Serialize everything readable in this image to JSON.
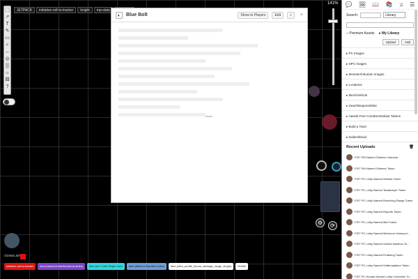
{
  "canvas": {
    "zoom": "141%",
    "tabs": [
      "JETPACK",
      "initiative-roll-to-tracker",
      "knight",
      "mp-stats",
      "target-pic"
    ]
  },
  "toolbar": {
    "tools": [
      "select-icon",
      "pointer-icon",
      "text-icon",
      "draw-icon",
      "shapes-icon",
      "zoom-icon",
      "measure-icon",
      "ping-icon",
      "fog-icon",
      "lighting-icon",
      "dice-icon",
      "help-icon"
    ]
  },
  "modal": {
    "title": "Blue Bolt",
    "show_to_players": "Show to Players",
    "edit": "Edit"
  },
  "sidebar": {
    "search_label": "Search:",
    "library_select": "Library",
    "radio_premium": "Premium Assets",
    "radio_library": "My Library",
    "upload": "Upload",
    "add": "Add",
    "categories": [
      "PC Images",
      "NPC Images",
      "Monster/Inhuman Images",
      "Locations",
      "Mech/Vehicle",
      "Gear/Weapons/Misc",
      "Hassle-Free Combat Modular Tokens",
      "Build a Town",
      "bodies/blood"
    ],
    "recent_title": "Recent Uploads",
    "recent_items": [
      "FIST PM Named Glimmer Handout",
      "FIST PM Named Glimmer Token",
      "FIST PC Leiby Named Wriesla Token",
      "FIST PC Leiby Named Tavakeeper Token",
      "FIST PC Leiby Named Resolving Range Token",
      "FIST PC Leiby Named Reports Token",
      "FIST PC Leiby Named Mint Token",
      "FIST PC Leiby Named Minicious Honeycut...",
      "FIST PC Leiby Named Golden Bamboo To...",
      "FIST PC Leiby Named Fluttering Token",
      "FIST PC Leiby Named Softtemptation Token",
      "FIST PC Human Named Leiby Combinen To..."
    ]
  },
  "player": {
    "name": "ODINELIEN"
  },
  "macros": [
    {
      "label": "initiative-roll-to-tracker",
      "bg": "#e01515",
      "fg": "#ffffff"
    },
    {
      "label": "item (wand-of-eldritch-flame-strike)",
      "bg": "#7b45c9",
      "fg": "#ffffff"
    },
    {
      "label": "item (Ice Cube Single Use)",
      "bg": "#33d6e0",
      "fg": "#003333"
    },
    {
      "label": "item (Mimic's Bundled Cube)",
      "bg": "#6f9fd8",
      "fg": "#111111"
    },
    {
      "label": "item (ultra_profile_bonus_damage_range_single)",
      "bg": "#ffffff",
      "fg": "#222222"
    },
    {
      "label": "HUNN",
      "bg": "#ffffff",
      "fg": "#222222"
    }
  ]
}
